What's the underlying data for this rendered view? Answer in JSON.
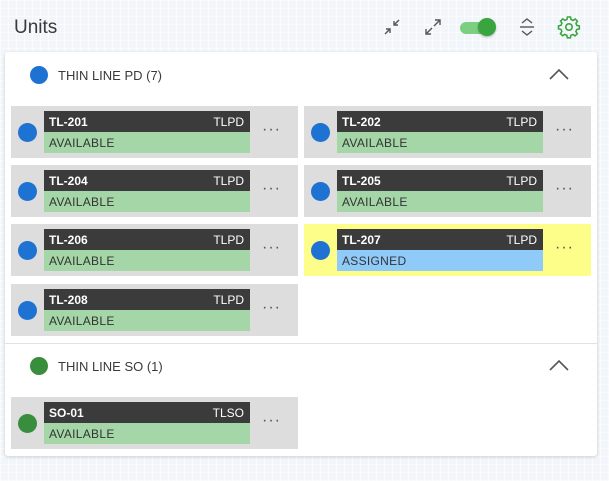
{
  "header": {
    "title": "Units",
    "icons": [
      "collapse-arrows-icon",
      "expand-arrows-icon",
      "toggle-switch",
      "unfold-icon",
      "gear-icon"
    ],
    "toggle_on": true,
    "accent": "#3aa43f"
  },
  "groups": [
    {
      "label": "THIN LINE PD (7)",
      "color": "#1e73d2",
      "expanded": true,
      "units": [
        {
          "id": "TL-201",
          "type": "TLPD",
          "status": "AVAILABLE"
        },
        {
          "id": "TL-202",
          "type": "TLPD",
          "status": "AVAILABLE"
        },
        {
          "id": "TL-204",
          "type": "TLPD",
          "status": "AVAILABLE"
        },
        {
          "id": "TL-205",
          "type": "TLPD",
          "status": "AVAILABLE"
        },
        {
          "id": "TL-206",
          "type": "TLPD",
          "status": "AVAILABLE"
        },
        {
          "id": "TL-207",
          "type": "TLPD",
          "status": "ASSIGNED"
        },
        {
          "id": "TL-208",
          "type": "TLPD",
          "status": "AVAILABLE"
        }
      ]
    },
    {
      "label": "THIN LINE SO (1)",
      "color": "#388e3c",
      "expanded": true,
      "units": [
        {
          "id": "SO-01",
          "type": "TLSO",
          "status": "AVAILABLE"
        }
      ]
    }
  ],
  "status_colors": {
    "AVAILABLE": "#a5d6a7",
    "ASSIGNED": "#90caf9"
  },
  "more_label": "···"
}
